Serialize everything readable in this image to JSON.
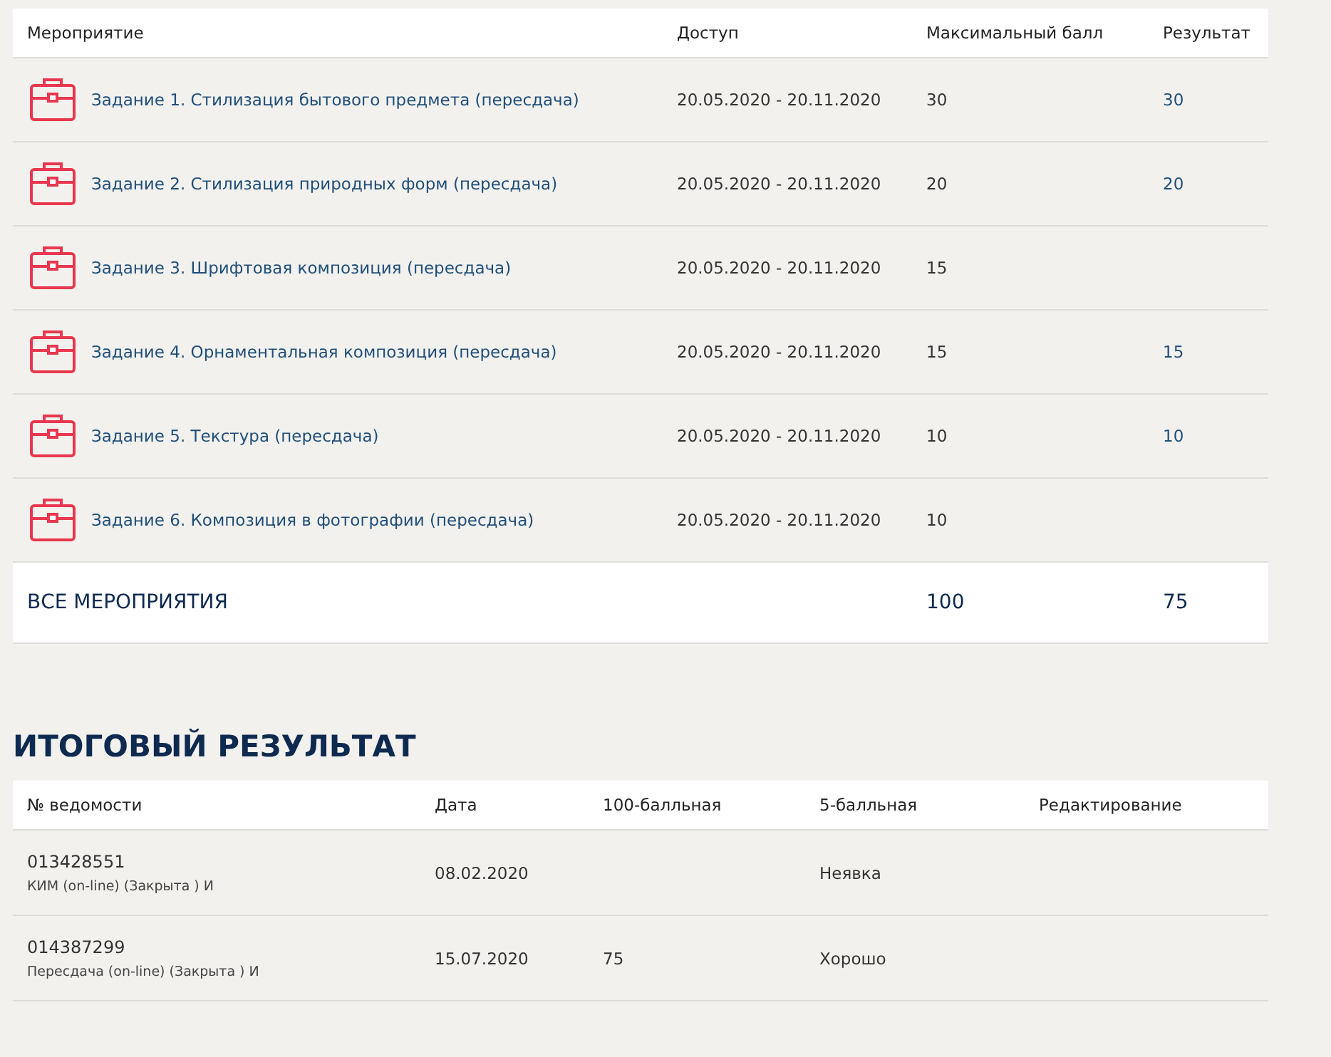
{
  "activities": {
    "columns": [
      "Мероприятие",
      "Доступ",
      "Максимальный балл",
      "Результат"
    ],
    "rows": [
      {
        "title": "Задание 1. Стилизация бытового предмета (пересдача)",
        "access": "20.05.2020 - 20.11.2020",
        "max": "30",
        "result": "30"
      },
      {
        "title": "Задание 2. Стилизация природных форм (пересдача)",
        "access": "20.05.2020 - 20.11.2020",
        "max": "20",
        "result": "20"
      },
      {
        "title": "Задание 3. Шрифтовая композиция (пересдача)",
        "access": "20.05.2020 - 20.11.2020",
        "max": "15"
      },
      {
        "title": "Задание 4. Орнаментальная композиция (пересдача)",
        "access": "20.05.2020 - 20.11.2020",
        "max": "15",
        "result": "15"
      },
      {
        "title": "Задание 5. Текстура (пересдача)",
        "access": "20.05.2020 - 20.11.2020",
        "max": "10",
        "result": "10"
      },
      {
        "title": "Задание 6. Композиция в фотографии (пересдача)",
        "access": "20.05.2020 - 20.11.2020",
        "max": "10"
      }
    ],
    "total": {
      "label": "ВСЕ МЕРОПРИЯТИЯ",
      "max": "100",
      "result": "75"
    }
  },
  "final": {
    "heading": "ИТОГОВЫЙ РЕЗУЛЬТАТ",
    "columns": [
      "№ ведомости",
      "Дата",
      "100-балльная",
      "5-балльная",
      "Редактирование"
    ],
    "rows": [
      {
        "number": "013428551",
        "note": "КИМ (on-line) (Закрыта ) И",
        "date": "08.02.2020",
        "grade5": "Неявка"
      },
      {
        "number": "014387299",
        "note": "Пересдача (on-line) (Закрыта ) И",
        "date": "15.07.2020",
        "grade100": "75",
        "grade5": "Хорошо"
      }
    ]
  }
}
